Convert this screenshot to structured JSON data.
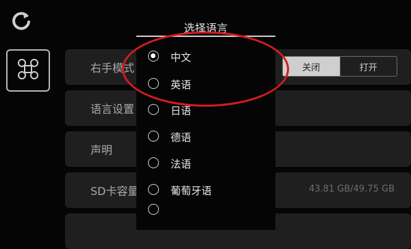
{
  "left": {
    "refresh_icon": "refresh-icon",
    "drone_icon": "drone-icon"
  },
  "settings": {
    "rows": [
      {
        "label": "右手模式",
        "toggle": {
          "off": "关闭",
          "on": "打开"
        }
      },
      {
        "label": "语言设置"
      },
      {
        "label": "声明"
      },
      {
        "label": "SD卡容量",
        "value": "43.81 GB/49.75 GB"
      },
      {
        "label": ""
      }
    ]
  },
  "dialog": {
    "title": "选择语言",
    "options": [
      {
        "label": "中文",
        "selected": true
      },
      {
        "label": "英语",
        "selected": false
      },
      {
        "label": "日语",
        "selected": false
      },
      {
        "label": "德语",
        "selected": false
      },
      {
        "label": "法语",
        "selected": false
      },
      {
        "label": "葡萄牙语",
        "selected": false
      },
      {
        "label": "",
        "selected": false
      }
    ]
  },
  "colors": {
    "background": "#050505",
    "row": "#1f1f1f",
    "annotation": "#d21c20"
  }
}
